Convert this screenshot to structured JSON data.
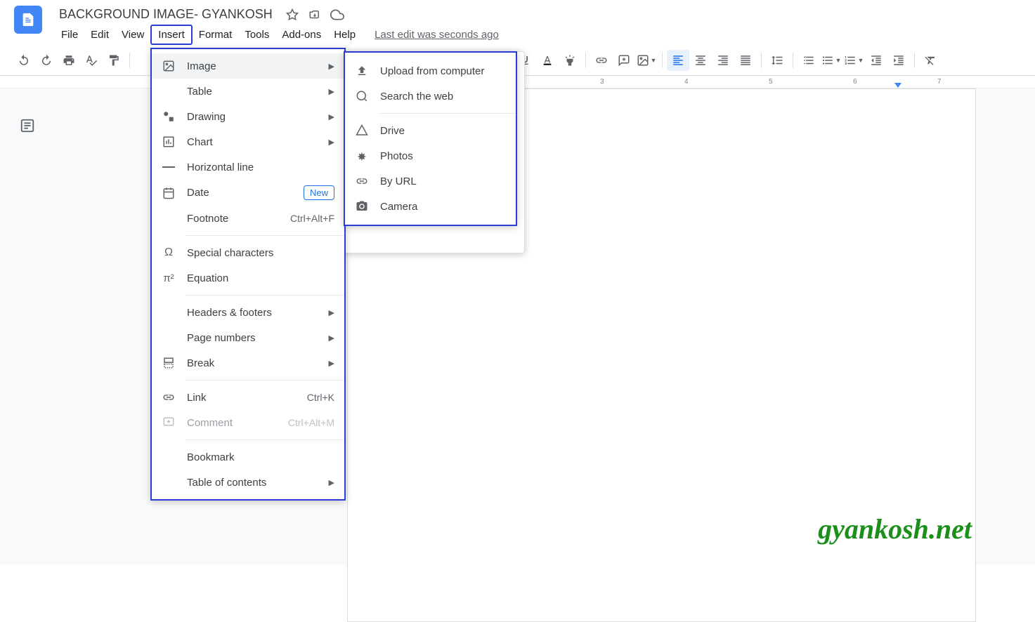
{
  "header": {
    "title": "BACKGROUND IMAGE- GYANKOSH",
    "last_edit": "Last edit was seconds ago"
  },
  "menus": {
    "file": "File",
    "edit": "Edit",
    "view": "View",
    "insert": "Insert",
    "format": "Format",
    "tools": "Tools",
    "addons": "Add-ons",
    "help": "Help"
  },
  "insert_menu": {
    "image": "Image",
    "table": "Table",
    "drawing": "Drawing",
    "chart": "Chart",
    "horizontal_line": "Horizontal line",
    "date": "Date",
    "date_badge": "New",
    "footnote": "Footnote",
    "footnote_shortcut": "Ctrl+Alt+F",
    "special_chars": "Special characters",
    "equation": "Equation",
    "headers_footers": "Headers & footers",
    "page_numbers": "Page numbers",
    "break": "Break",
    "link": "Link",
    "link_shortcut": "Ctrl+K",
    "comment": "Comment",
    "comment_shortcut": "Ctrl+Alt+M",
    "bookmark": "Bookmark",
    "toc": "Table of contents"
  },
  "image_menu": {
    "upload": "Upload from computer",
    "search_web": "Search the web",
    "drive": "Drive",
    "photos": "Photos",
    "by_url": "By URL",
    "camera": "Camera"
  },
  "ruler": {
    "marks": [
      "3",
      "4",
      "5",
      "6",
      "7"
    ]
  },
  "watermark": "gyankosh.net"
}
